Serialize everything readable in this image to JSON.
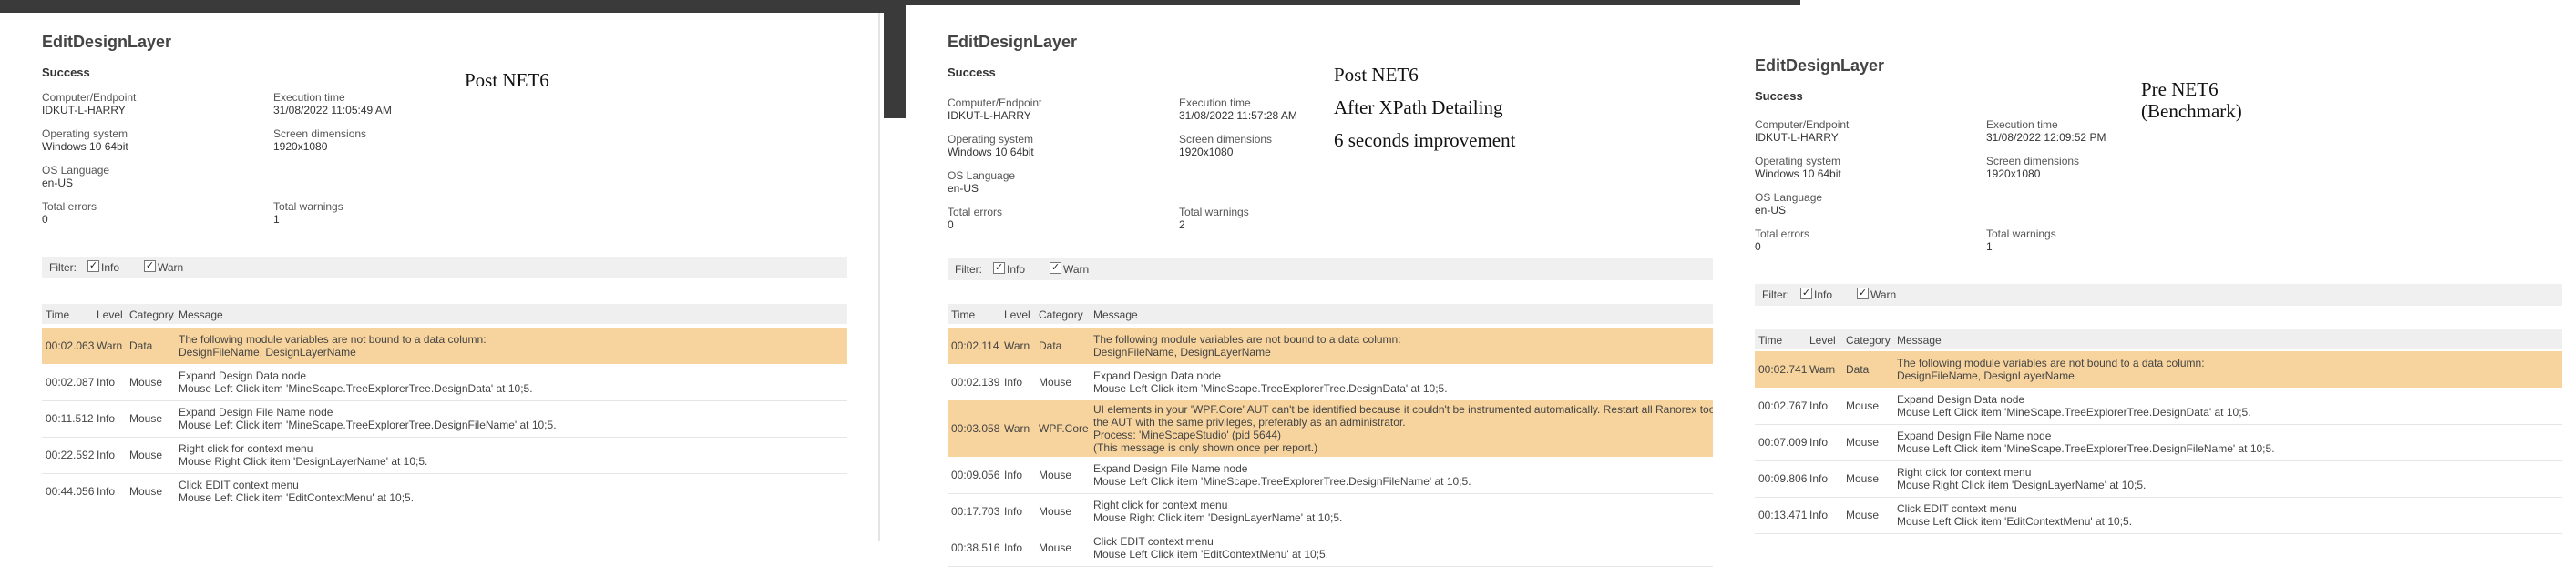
{
  "colors": {
    "warn_row": "#f7d49d",
    "filter_bg": "#f0f0f0",
    "header_bg": "#efefef",
    "dark_bar": "#3a3a3a"
  },
  "headers": {
    "time": "Time",
    "level": "Level",
    "category": "Category",
    "message": "Message"
  },
  "filter": {
    "label": "Filter:",
    "info": "Info",
    "warn": "Warn",
    "info_checked": true,
    "warn_checked": true
  },
  "info_labels": {
    "computer": "Computer/Endpoint",
    "exec_time": "Execution time",
    "os": "Operating system",
    "screen": "Screen dimensions",
    "lang": "OS Language",
    "errors": "Total errors",
    "warnings": "Total warnings"
  },
  "panels": [
    {
      "title": "EditDesignLayer",
      "status": "Success",
      "note": [
        "Post NET6"
      ],
      "computer": "IDKUT-L-HARRY",
      "exec_time": "31/08/2022 11:05:49 AM",
      "os": "Windows 10 64bit",
      "screen": "1920x1080",
      "lang": "en-US",
      "errors": "0",
      "warnings": "1",
      "rows": [
        {
          "time": "00:02.063",
          "level": "Warn",
          "category": "Data",
          "msg": [
            "The following module variables are not bound to a data column:",
            "DesignFileName, DesignLayerName"
          ]
        },
        {
          "time": "00:02.087",
          "level": "Info",
          "category": "Mouse",
          "msg": [
            "Expand Design Data node",
            "Mouse Left Click item 'MineScape.TreeExplorerTree.DesignData' at 10;5."
          ]
        },
        {
          "time": "00:11.512",
          "level": "Info",
          "category": "Mouse",
          "msg": [
            "Expand Design File Name node",
            "Mouse Left Click item 'MineScape.TreeExplorerTree.DesignFileName' at 10;5."
          ]
        },
        {
          "time": "00:22.592",
          "level": "Info",
          "category": "Mouse",
          "msg": [
            "Right click for context menu",
            "Mouse Right Click item 'DesignLayerName' at 10;5."
          ]
        },
        {
          "time": "00:44.056",
          "level": "Info",
          "category": "Mouse",
          "msg": [
            "Click EDIT context menu",
            "Mouse Left Click item 'EditContextMenu' at 10;5."
          ]
        }
      ]
    },
    {
      "title": "EditDesignLayer",
      "status": "Success",
      "note": [
        "Post NET6",
        "After XPath Detailing",
        "6 seconds improvement"
      ],
      "computer": "IDKUT-L-HARRY",
      "exec_time": "31/08/2022 11:57:28 AM",
      "os": "Windows 10 64bit",
      "screen": "1920x1080",
      "lang": "en-US",
      "errors": "0",
      "warnings": "2",
      "rows": [
        {
          "time": "00:02.114",
          "level": "Warn",
          "category": "Data",
          "msg": [
            "The following module variables are not bound to a data column:",
            "DesignFileName, DesignLayerName"
          ]
        },
        {
          "time": "00:02.139",
          "level": "Info",
          "category": "Mouse",
          "msg": [
            "Expand Design Data node",
            "Mouse Left Click item 'MineScape.TreeExplorerTree.DesignData' at 10;5."
          ]
        },
        {
          "time": "00:03.058",
          "level": "Warn",
          "category": "WPF.Core",
          "msg": [
            "UI elements in your 'WPF.Core' AUT can't be identified because it couldn't be instrumented automatically. Restart all Ranorex tools and",
            "the AUT with the same privileges, preferably as an administrator.",
            "Process: 'MineScapeStudio' (pid 5644)",
            "(This message is only shown once per report.)"
          ]
        },
        {
          "time": "00:09.056",
          "level": "Info",
          "category": "Mouse",
          "msg": [
            "Expand Design File Name node",
            "Mouse Left Click item 'MineScape.TreeExplorerTree.DesignFileName' at 10;5."
          ]
        },
        {
          "time": "00:17.703",
          "level": "Info",
          "category": "Mouse",
          "msg": [
            "Right click for context menu",
            "Mouse Right Click item 'DesignLayerName' at 10;5."
          ]
        },
        {
          "time": "00:38.516",
          "level": "Info",
          "category": "Mouse",
          "msg": [
            "Click EDIT context menu",
            "Mouse Left Click item 'EditContextMenu' at 10;5."
          ]
        }
      ]
    },
    {
      "title": "EditDesignLayer",
      "status": "Success",
      "note": [
        "Pre NET6",
        "(Benchmark)"
      ],
      "computer": "IDKUT-L-HARRY",
      "exec_time": "31/08/2022 12:09:52 PM",
      "os": "Windows 10 64bit",
      "screen": "1920x1080",
      "lang": "en-US",
      "errors": "0",
      "warnings": "1",
      "rows": [
        {
          "time": "00:02.741",
          "level": "Warn",
          "category": "Data",
          "msg": [
            "The following module variables are not bound to a data column:",
            "DesignFileName, DesignLayerName"
          ]
        },
        {
          "time": "00:02.767",
          "level": "Info",
          "category": "Mouse",
          "msg": [
            "Expand Design Data node",
            "Mouse Left Click item 'MineScape.TreeExplorerTree.DesignData' at 10;5."
          ]
        },
        {
          "time": "00:07.009",
          "level": "Info",
          "category": "Mouse",
          "msg": [
            "Expand Design File Name node",
            "Mouse Left Click item 'MineScape.TreeExplorerTree.DesignFileName' at 10;5."
          ]
        },
        {
          "time": "00:09.806",
          "level": "Info",
          "category": "Mouse",
          "msg": [
            "Right click for context menu",
            "Mouse Right Click item 'DesignLayerName' at 10;5."
          ]
        },
        {
          "time": "00:13.471",
          "level": "Info",
          "category": "Mouse",
          "msg": [
            "Click EDIT context menu",
            "Mouse Left Click item 'EditContextMenu' at 10;5."
          ]
        }
      ]
    }
  ]
}
